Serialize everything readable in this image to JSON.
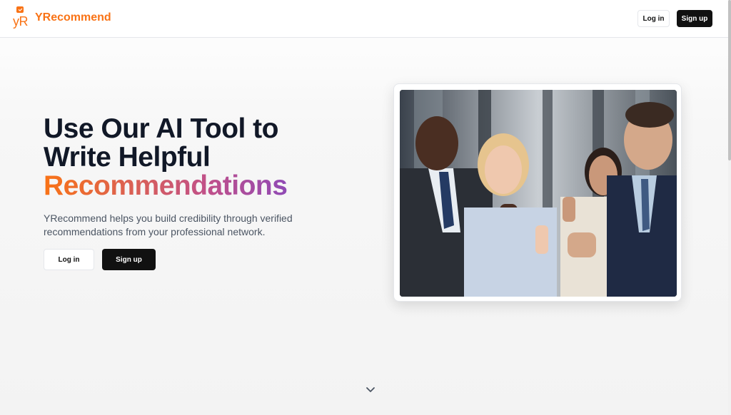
{
  "header": {
    "logo_text": "yR",
    "brand": "YRecommend",
    "login_label": "Log in",
    "signup_label": "Sign up"
  },
  "hero": {
    "title_line1": "Use Our AI Tool to",
    "title_line2": "Write Helpful",
    "title_line3": "Recommendations",
    "subtitle": "YRecommend helps you build credibility through verified recommendations from your professional network.",
    "login_label": "Log in",
    "signup_label": "Sign up"
  },
  "image": {
    "icon": "team-photo"
  },
  "colors": {
    "brand": "#f97316",
    "gradient_start": "#f97316",
    "gradient_end": "#6d45d4",
    "primary_button": "#111111"
  }
}
